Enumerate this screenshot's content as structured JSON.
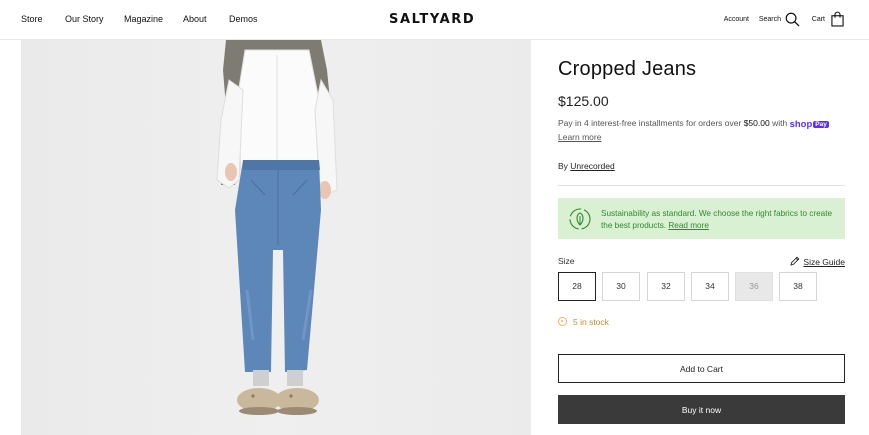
{
  "header": {
    "nav": [
      "Store",
      "Our Story",
      "Magazine",
      "About",
      "Demos"
    ],
    "logo": "SALTYARD",
    "account_label": "Account",
    "search_label": "Search",
    "cart_label": "Cart"
  },
  "product": {
    "title": "Cropped Jeans",
    "price": "$125.00",
    "installments_prefix": "Pay in 4 interest-free installments for orders over",
    "installments_amount": "$50.00",
    "installments_with": "with",
    "shop_label": "shop",
    "pay_label": "Pay",
    "learn_more": "Learn more",
    "by_label": "By",
    "vendor": "Unrecorded"
  },
  "sustainability": {
    "text": "Sustainability as standard. We choose the right fabrics to create the best products.",
    "read_more": "Read more"
  },
  "sizes": {
    "label": "Size",
    "guide_label": "Size Guide",
    "options": [
      "28",
      "30",
      "32",
      "34",
      "36",
      "38"
    ],
    "selected": "28",
    "unavailable": [
      "36"
    ]
  },
  "stock": {
    "text": "5 in stock"
  },
  "actions": {
    "add_to_cart": "Add to Cart",
    "buy_now": "Buy it now"
  },
  "colors": {
    "accent_pay": "#5a31f4",
    "sustain_bg": "#d9f0d3",
    "sustain_text": "#2f8a2f",
    "stock": "#c88a2a",
    "buy_bg": "#3a3a3a"
  }
}
